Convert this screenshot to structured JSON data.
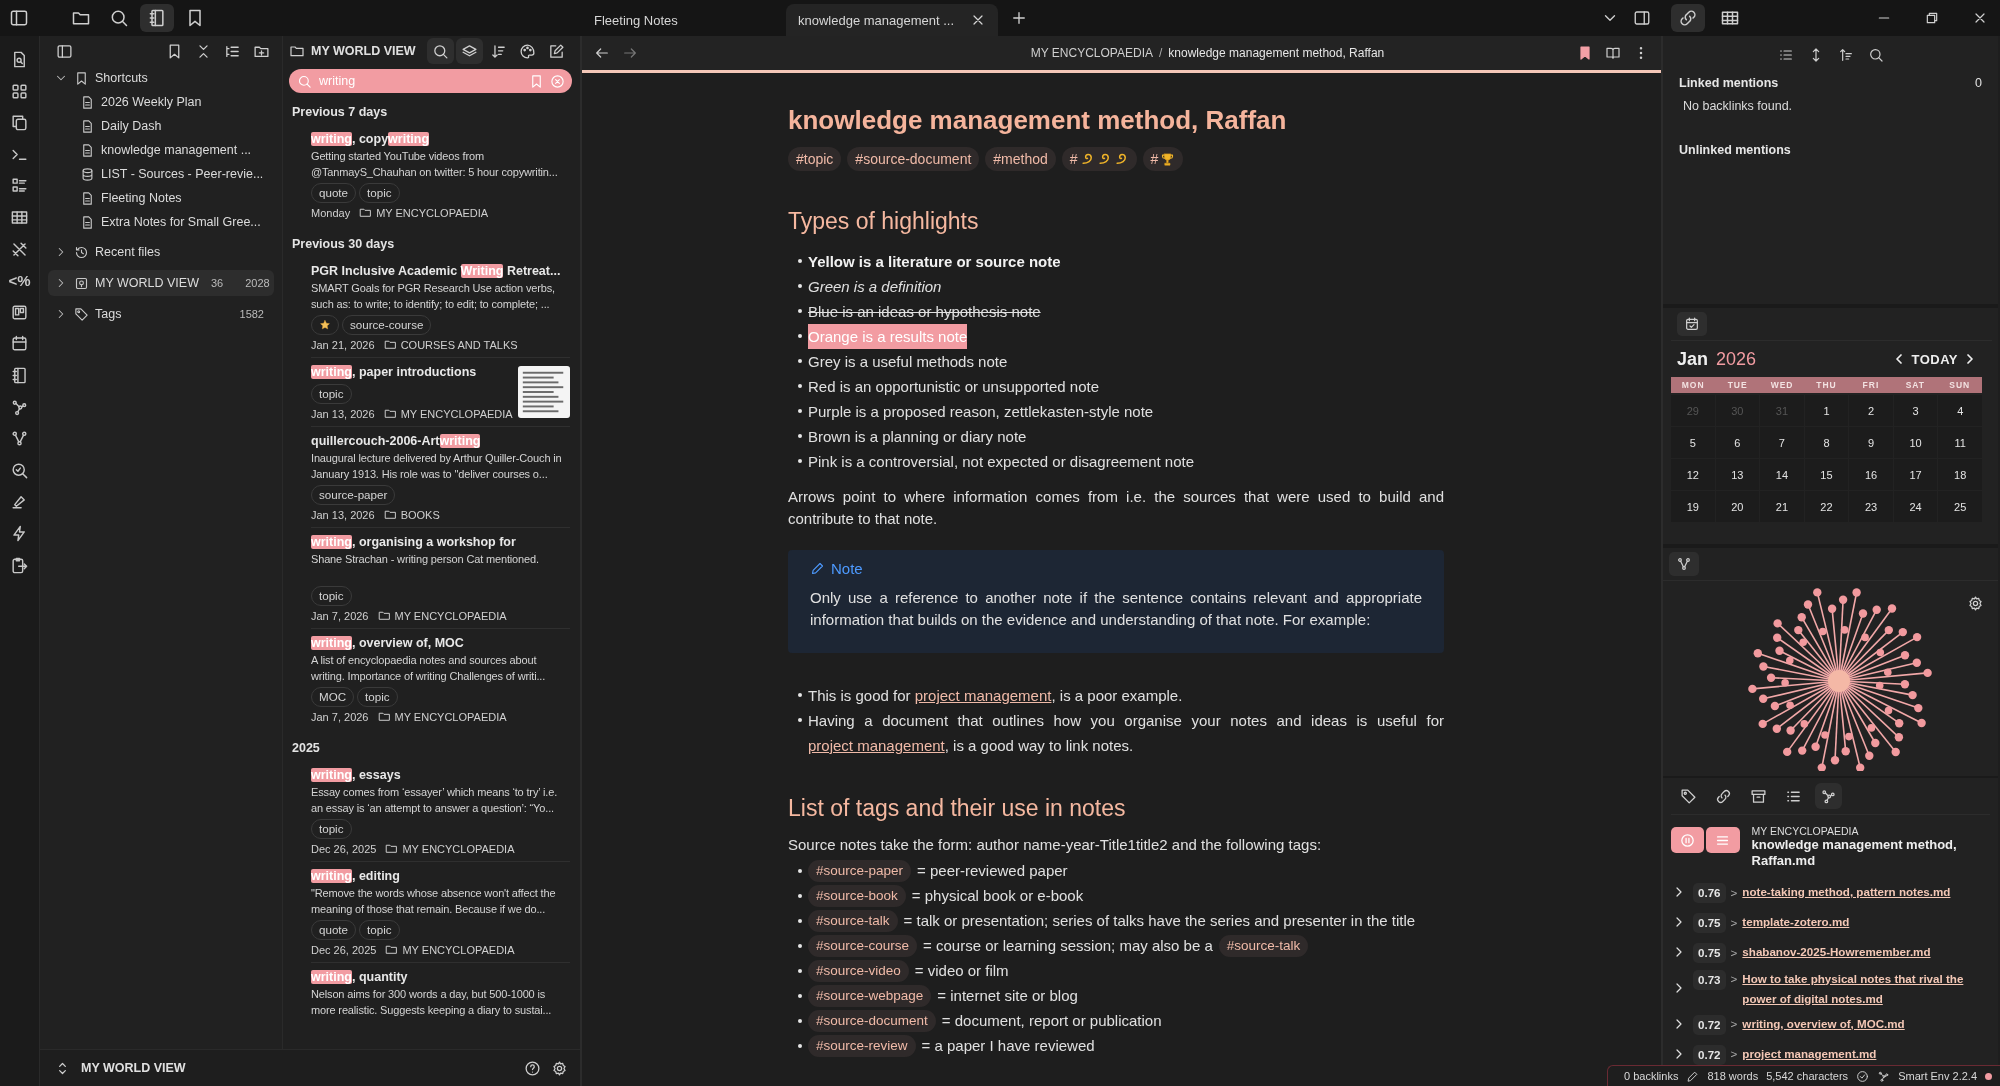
{
  "top_toolbar": [
    {
      "selected": false
    },
    {
      "selected": false
    },
    {
      "selected": false
    },
    {
      "selected": true
    },
    {
      "selected": false
    }
  ],
  "tabs": [
    {
      "label": "Fleeting Notes",
      "selected": false
    },
    {
      "label": "knowledge management ...",
      "selected": true
    }
  ],
  "right_toolbar": [
    {
      "selected": true
    },
    {
      "selected": false
    }
  ],
  "ribbon": {
    "template_label": "<%"
  },
  "file_tree": {
    "shortcuts": {
      "label": "Shortcuts",
      "expanded": true,
      "items": [
        {
          "label": "2026 Weekly Plan",
          "kind": "note"
        },
        {
          "label": "Daily Dash",
          "kind": "note"
        },
        {
          "label": "knowledge management ...",
          "kind": "note"
        },
        {
          "label": "LIST - Sources - Peer-revie...",
          "kind": "base"
        },
        {
          "label": "Fleeting Notes",
          "kind": "note"
        },
        {
          "label": "Extra Notes for Small Gree...",
          "kind": "note"
        }
      ]
    },
    "sections": [
      {
        "label": "Recent files",
        "kind": "recent",
        "expanded": false,
        "selected": false
      },
      {
        "label": "MY WORLD VIEW",
        "kind": "vault",
        "expanded": false,
        "selected": true,
        "count": "36",
        "total": "2028"
      },
      {
        "label": "Tags",
        "kind": "tags",
        "expanded": false,
        "selected": false,
        "count": "1582"
      }
    ]
  },
  "navigator": {
    "title": "MY WORLD VIEW",
    "toolbar": [
      {
        "selected": true
      },
      {
        "selected": true
      },
      {
        "selected": false
      },
      {
        "selected": false
      },
      {
        "selected": false
      }
    ],
    "search": {
      "value": "writing"
    },
    "groups": [
      {
        "heading": "Previous 7 days",
        "notes": [
          {
            "title": [
              {
                "text": "writing",
                "highlight": true
              },
              {
                "text": ", copy",
                "highlight": false
              },
              {
                "text": "writing",
                "highlight": true
              }
            ],
            "excerpt": "Getting started YouTube videos from @TanmayS_Chauhan on twitter: 5 hour copywritin...",
            "gap": false,
            "tags": [
              {
                "kind": "text",
                "label": "quote"
              },
              {
                "kind": "text",
                "label": "topic"
              }
            ],
            "date": "Monday",
            "folder": "MY ENCYCLOPAEDIA"
          }
        ]
      },
      {
        "heading": "Previous 30 days",
        "notes": [
          {
            "title": [
              {
                "text": "PGR Inclusive Academic ",
                "highlight": false
              },
              {
                "text": "Writing",
                "highlight": true
              },
              {
                "text": " Retreat...",
                "highlight": false
              }
            ],
            "excerpt": "SMART Goals for PGR Research Use action verbs, such as: to write; to identify; to edit; to complete; ...",
            "gap": false,
            "tags": [
              {
                "kind": "star"
              },
              {
                "kind": "text",
                "label": "source-course"
              }
            ],
            "date": "Jan 21, 2026",
            "folder": "COURSES AND TALKS"
          },
          {
            "title": [
              {
                "text": "writing",
                "highlight": true
              },
              {
                "text": ", paper introductions",
                "highlight": false
              }
            ],
            "tags": [
              {
                "kind": "text",
                "label": "topic"
              }
            ],
            "date": "Jan 13, 2026",
            "folder": "MY ENCYCLOPAEDIA",
            "thumbnail": true
          },
          {
            "title": [
              {
                "text": "quillercouch-2006-Art",
                "highlight": false
              },
              {
                "text": "writing",
                "highlight": true
              }
            ],
            "excerpt": "Inaugural lecture delivered by Arthur Quiller-Couch in January 1913. His role was to \"deliver courses o...",
            "gap": false,
            "tags": [
              {
                "kind": "text",
                "label": "source-paper"
              }
            ],
            "date": "Jan 13, 2026",
            "folder": "BOOKS"
          },
          {
            "title": [
              {
                "text": "writing",
                "highlight": true
              },
              {
                "text": ", organising a workshop for",
                "highlight": false
              }
            ],
            "excerpt": "Shane Strachan - writing person Cat mentioned.",
            "gap": true,
            "tags": [
              {
                "kind": "text",
                "label": "topic"
              }
            ],
            "date": "Jan 7, 2026",
            "folder": "MY ENCYCLOPAEDIA"
          },
          {
            "title": [
              {
                "text": "writing",
                "highlight": true
              },
              {
                "text": ", overview of, MOC",
                "highlight": false
              }
            ],
            "excerpt": "A list of encyclopaedia notes and sources about writing. Importance of writing Challenges of writi...",
            "gap": false,
            "tags": [
              {
                "kind": "text",
                "label": "MOC"
              },
              {
                "kind": "text",
                "label": "topic"
              }
            ],
            "date": "Jan 7, 2026",
            "folder": "MY ENCYCLOPAEDIA"
          }
        ]
      },
      {
        "heading": "2025",
        "notes": [
          {
            "title": [
              {
                "text": "writing",
                "highlight": true
              },
              {
                "text": ", essays",
                "highlight": false
              }
            ],
            "excerpt": "Essay comes from ‘essayer’ which means ‘to try’ i.e. an essay is ‘an attempt to answer a question’: “Yo...",
            "gap": false,
            "tags": [
              {
                "kind": "text",
                "label": "topic"
              }
            ],
            "date": "Dec 26, 2025",
            "folder": "MY ENCYCLOPAEDIA"
          },
          {
            "title": [
              {
                "text": "writing",
                "highlight": true
              },
              {
                "text": ", editing",
                "highlight": false
              }
            ],
            "excerpt": "\"Remove the words whose absence won't affect the meaning of those that remain. Because if we do...",
            "gap": false,
            "tags": [
              {
                "kind": "text",
                "label": "quote"
              },
              {
                "kind": "text",
                "label": "topic"
              }
            ],
            "date": "Dec 26, 2025",
            "folder": "MY ENCYCLOPAEDIA"
          },
          {
            "title": [
              {
                "text": "writing",
                "highlight": true
              },
              {
                "text": ", quantity",
                "highlight": false
              }
            ],
            "excerpt": "Nelson aims for 300 words a day, but 500-1000 is more realistic. Suggests keeping a diary to sustai...",
            "gap": false
          }
        ]
      }
    ],
    "footer": "MY WORLD VIEW"
  },
  "editor": {
    "breadcrumb": {
      "folder": "MY ENCYCLOPAEDIA",
      "separator": "/",
      "current": "knowledge management method, Raffan"
    },
    "bookmarked": true,
    "title": "knowledge management method, Raffan",
    "blocks": [
      {
        "kind": "tags",
        "tags": [
          {
            "kind": "text",
            "label": "#topic"
          },
          {
            "kind": "text",
            "label": "#source-document"
          },
          {
            "kind": "text",
            "label": "#method"
          },
          {
            "kind": "swirls",
            "label": "#"
          },
          {
            "kind": "trophy",
            "label": "#"
          }
        ]
      },
      {
        "kind": "heading",
        "text": "Types of highlights"
      },
      {
        "kind": "styled_list",
        "items": [
          {
            "kind": "bold",
            "text": "Yellow is a literature or source note"
          },
          {
            "kind": "italic",
            "text": "Green is a definition"
          },
          {
            "kind": "strike",
            "text": "Blue is an ideas or hypothesis note"
          },
          {
            "kind": "highlight",
            "text": "Orange is a results note"
          },
          {
            "kind": "plain",
            "text": "Grey is a useful methods note"
          },
          {
            "kind": "plain",
            "text": "Red is an opportunistic or unsupported note"
          },
          {
            "kind": "plain",
            "text": "Purple is a proposed reason, zettlekasten-style note"
          },
          {
            "kind": "plain",
            "text": "Brown is a planning or diary note"
          },
          {
            "kind": "plain",
            "text": "Pink is a controversial, not expected or disagreement note"
          }
        ]
      },
      {
        "kind": "paragraph",
        "text": "Arrows point to where information comes from i.e. the sources that were used to build and contribute to that note."
      },
      {
        "kind": "callout",
        "title": "Note",
        "text": "Only use a reference to another note if the sentence contains relevant and appropriate information that builds on the evidence and understanding of that note. For example:"
      },
      {
        "kind": "link_list",
        "items": [
          {
            "parts": [
              {
                "text": "This is good for ",
                "link": false
              },
              {
                "text": "project management",
                "link": true
              },
              {
                "text": ", is a poor example.",
                "link": false
              }
            ]
          },
          {
            "parts": [
              {
                "text": "Having a document that outlines how you organise your notes and ideas is useful for ",
                "link": false
              },
              {
                "text": "project management",
                "link": true
              },
              {
                "text": ", is a good way to link notes.",
                "link": false
              }
            ]
          }
        ]
      },
      {
        "kind": "heading",
        "text": "List of tags and their use in notes"
      },
      {
        "kind": "intro",
        "text": "Source notes take the form: author name-year-Title1title2 and the following tags:"
      },
      {
        "kind": "tag_list",
        "items": [
          {
            "tag": "#source-paper",
            "text": "= peer-reviewed paper"
          },
          {
            "tag": "#source-book",
            "text": "= physical book or e-book"
          },
          {
            "tag": "#source-talk",
            "text": "= talk or presentation; series of talks have the series and presenter in the title"
          },
          {
            "tag": "#source-course",
            "text": "= course or learning session; may also be a",
            "tag_after": "#source-talk"
          },
          {
            "tag": "#source-video",
            "text": "= video or film"
          },
          {
            "tag": "#source-webpage",
            "text": "= internet site or blog"
          },
          {
            "tag": "#source-document",
            "text": "= document, report or publication"
          },
          {
            "tag": "#source-review",
            "text": "= a paper I have reviewed"
          }
        ]
      }
    ]
  },
  "backlinks": {
    "linked": "Linked mentions",
    "linked_count": "0",
    "empty": "No backlinks found.",
    "unlinked": "Unlinked mentions"
  },
  "calendar": {
    "month": "Jan",
    "year": "2026",
    "today": "TODAY",
    "weekdays": [
      "MON",
      "TUE",
      "WED",
      "THU",
      "FRI",
      "SAT",
      "SUN"
    ],
    "weeks": [
      [
        {
          "day": "29",
          "muted": true
        },
        {
          "day": "30",
          "muted": true
        },
        {
          "day": "31",
          "muted": true
        },
        {
          "day": "1",
          "muted": false
        },
        {
          "day": "2",
          "muted": false
        },
        {
          "day": "3",
          "muted": false
        },
        {
          "day": "4",
          "muted": false
        }
      ],
      [
        {
          "day": "5",
          "muted": false
        },
        {
          "day": "6",
          "muted": false
        },
        {
          "day": "7",
          "muted": false
        },
        {
          "day": "8",
          "muted": false
        },
        {
          "day": "9",
          "muted": false
        },
        {
          "day": "10",
          "muted": false
        },
        {
          "day": "11",
          "muted": false
        }
      ],
      [
        {
          "day": "12",
          "muted": false
        },
        {
          "day": "13",
          "muted": false
        },
        {
          "day": "14",
          "muted": false
        },
        {
          "day": "15",
          "muted": false
        },
        {
          "day": "16",
          "muted": false
        },
        {
          "day": "17",
          "muted": false
        },
        {
          "day": "18",
          "muted": false
        }
      ],
      [
        {
          "day": "19",
          "muted": false
        },
        {
          "day": "20",
          "muted": false
        },
        {
          "day": "21",
          "muted": false
        },
        {
          "day": "22",
          "muted": false
        },
        {
          "day": "23",
          "muted": false
        },
        {
          "day": "24",
          "muted": false
        },
        {
          "day": "25",
          "muted": false
        }
      ]
    ]
  },
  "smart": {
    "tabs": [
      {
        "selected": false
      },
      {
        "selected": false
      },
      {
        "selected": false
      },
      {
        "selected": false
      },
      {
        "selected": true
      }
    ],
    "folder": "MY ENCYCLOPAEDIA",
    "file": "knowledge management method, Raffan.md",
    "results": [
      {
        "score": "0.76",
        "separator": ">",
        "label": "note-taking method, pattern notes.md",
        "expanded": false
      },
      {
        "score": "0.75",
        "separator": ">",
        "label": "template-zotero.md",
        "expanded": false
      },
      {
        "score": "0.75",
        "separator": ">",
        "label": "shabanov-2025-Howremember.md",
        "expanded": false
      },
      {
        "score": "0.73",
        "separator": ">",
        "label": "How to take physical notes that rival the power of digital notes.md",
        "expanded": false
      },
      {
        "score": "0.72",
        "separator": ">",
        "label": "writing, overview of, MOC.md",
        "expanded": false
      },
      {
        "score": "0.72",
        "separator": ">",
        "label": "project management.md",
        "expanded": false
      }
    ]
  },
  "status_bar": {
    "backlinks": "0 backlinks",
    "words": "818 words",
    "characters": "5,542 characters",
    "plugin": "Smart Env 2.2.4"
  }
}
